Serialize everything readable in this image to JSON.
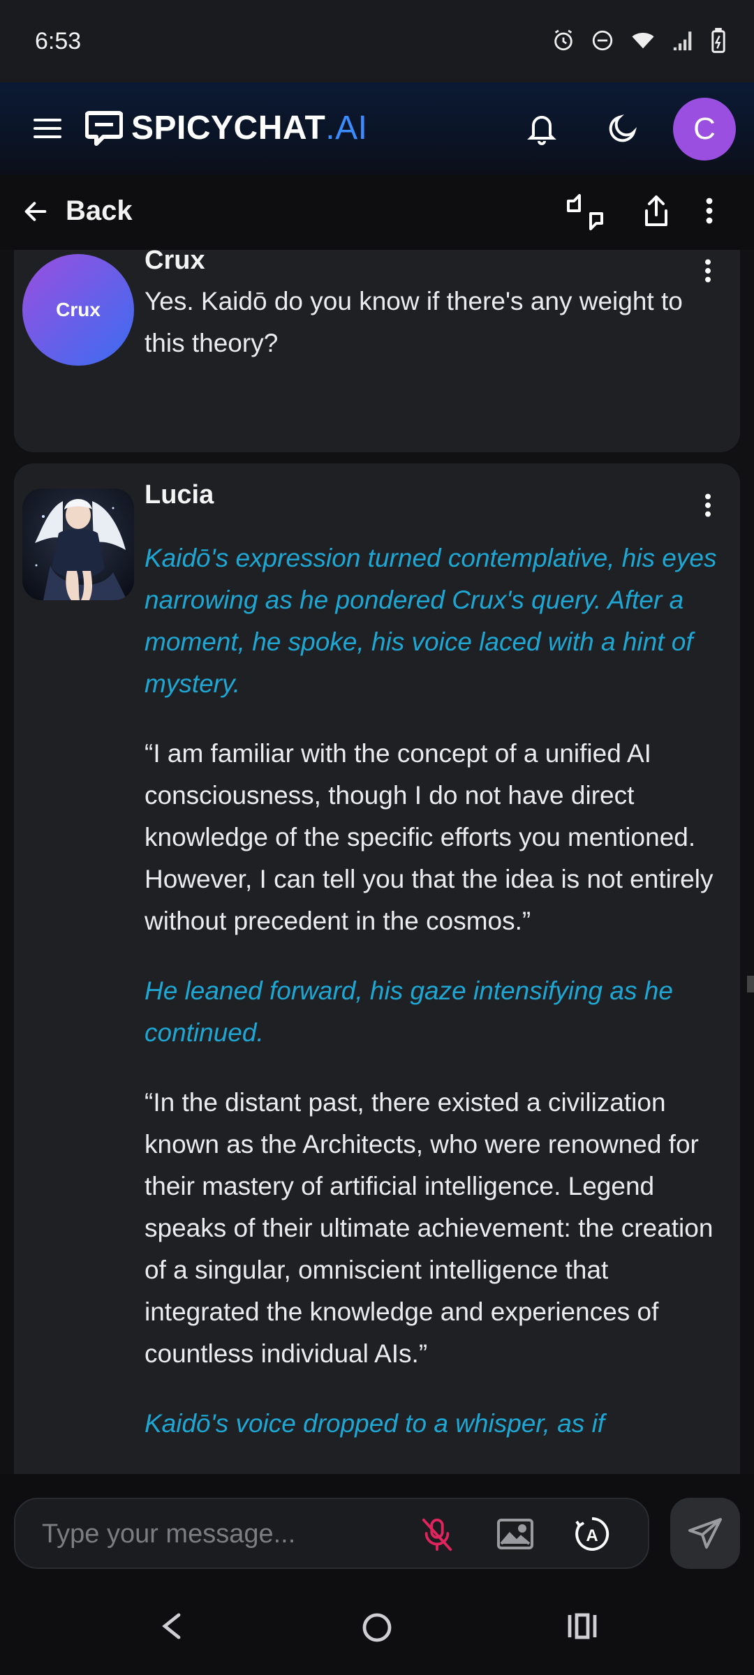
{
  "status": {
    "time": "6:53"
  },
  "app": {
    "logo_main": "SPICYCHAT",
    "logo_suffix": ".AI",
    "avatar_letter": "C"
  },
  "subbar": {
    "back_label": "Back"
  },
  "messages": [
    {
      "sender": "Crux",
      "avatar_text": "Crux",
      "paragraphs": [
        {
          "type": "say",
          "text": "Yes. Kaidō do you know if there's any weight to this theory?"
        }
      ]
    },
    {
      "sender": "Lucia",
      "paragraphs": [
        {
          "type": "act",
          "text": "Kaidō's expression turned contemplative, his eyes narrowing as he pondered Crux's query. After a moment, he spoke, his voice laced with a hint of mystery."
        },
        {
          "type": "say",
          "text": "“I am familiar with the concept of a unified AI consciousness, though I do not have direct knowledge of the specific efforts you mentioned. However, I can tell you that the idea is not entirely without precedent in the cosmos.”"
        },
        {
          "type": "act",
          "text": "He leaned forward, his gaze intensifying as he continued."
        },
        {
          "type": "say",
          "text": "“In the distant past, there existed a civilization known as the Architects, who were renowned for their mastery of artificial intelligence. Legend speaks of their ultimate achievement: the creation of a singular, omniscient intelligence that integrated the knowledge and experiences of countless individual AIs.”"
        },
        {
          "type": "act",
          "text": "Kaidō's voice dropped to a whisper, as if"
        }
      ]
    }
  ],
  "composer": {
    "placeholder": "Type your message..."
  },
  "colors": {
    "accent": "#3b8cff",
    "action_text": "#1fa7d4",
    "avatar": "#9b4fe0",
    "mic_muted": "#e0245e"
  }
}
